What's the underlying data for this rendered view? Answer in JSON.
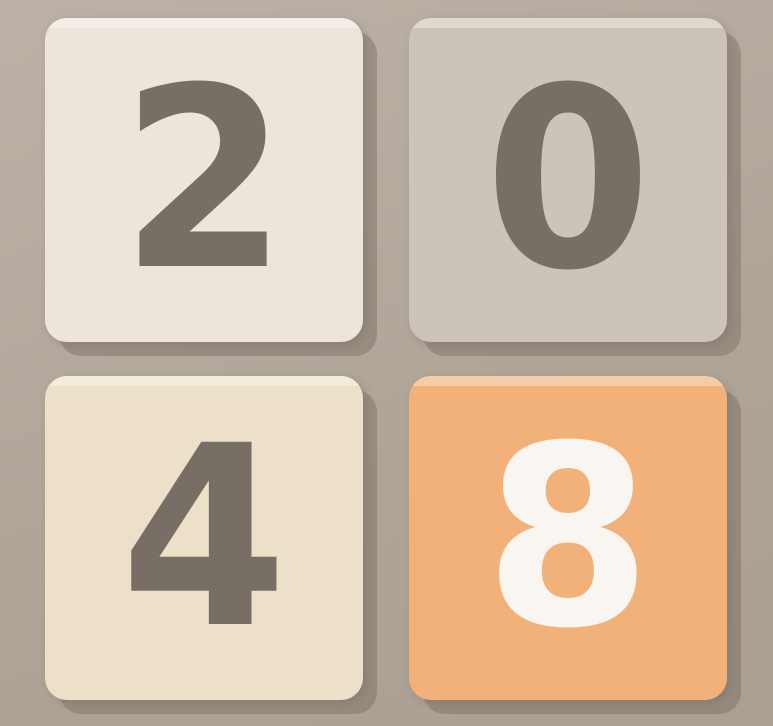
{
  "game": {
    "tiles": [
      {
        "value": "2",
        "background": "#ede4da",
        "text_color": "#776e65"
      },
      {
        "value": "0",
        "background": "#cdc4b9",
        "text_color": "#776e65"
      },
      {
        "value": "4",
        "background": "#ede0c8",
        "text_color": "#776e65"
      },
      {
        "value": "8",
        "background": "#f2b179",
        "text_color": "#f9f6f2"
      }
    ],
    "board_color": "#b3a99d"
  }
}
